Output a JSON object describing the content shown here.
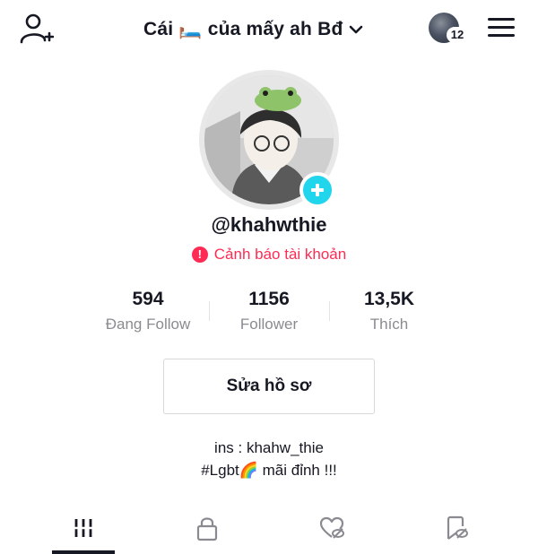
{
  "header": {
    "title": "Cái 🛏️ của mấy ah Bđ",
    "notification_count": "12"
  },
  "profile": {
    "username": "@khahwthie",
    "warning_text": "Cảnh báo tài khoản",
    "warning_icon": "!"
  },
  "stats": [
    {
      "value": "594",
      "label": "Đang Follow"
    },
    {
      "value": "1156",
      "label": "Follower"
    },
    {
      "value": "13,5K",
      "label": "Thích"
    }
  ],
  "actions": {
    "edit_profile": "Sửa hồ sơ"
  },
  "bio": {
    "line1": "ins : khahw_thie",
    "line2": "#Lgbt🌈 mãi đỉnh !!!"
  },
  "tabs": [
    {
      "icon": "grid-videos-icon",
      "active": true
    },
    {
      "icon": "lock-icon",
      "active": false
    },
    {
      "icon": "liked-hidden-icon",
      "active": false
    },
    {
      "icon": "bookmark-hidden-icon",
      "active": false
    }
  ],
  "colors": {
    "accent_red": "#fe2c55",
    "plus_cyan": "#20d5ec",
    "text_primary": "#161823",
    "text_secondary": "#8a8b91"
  }
}
